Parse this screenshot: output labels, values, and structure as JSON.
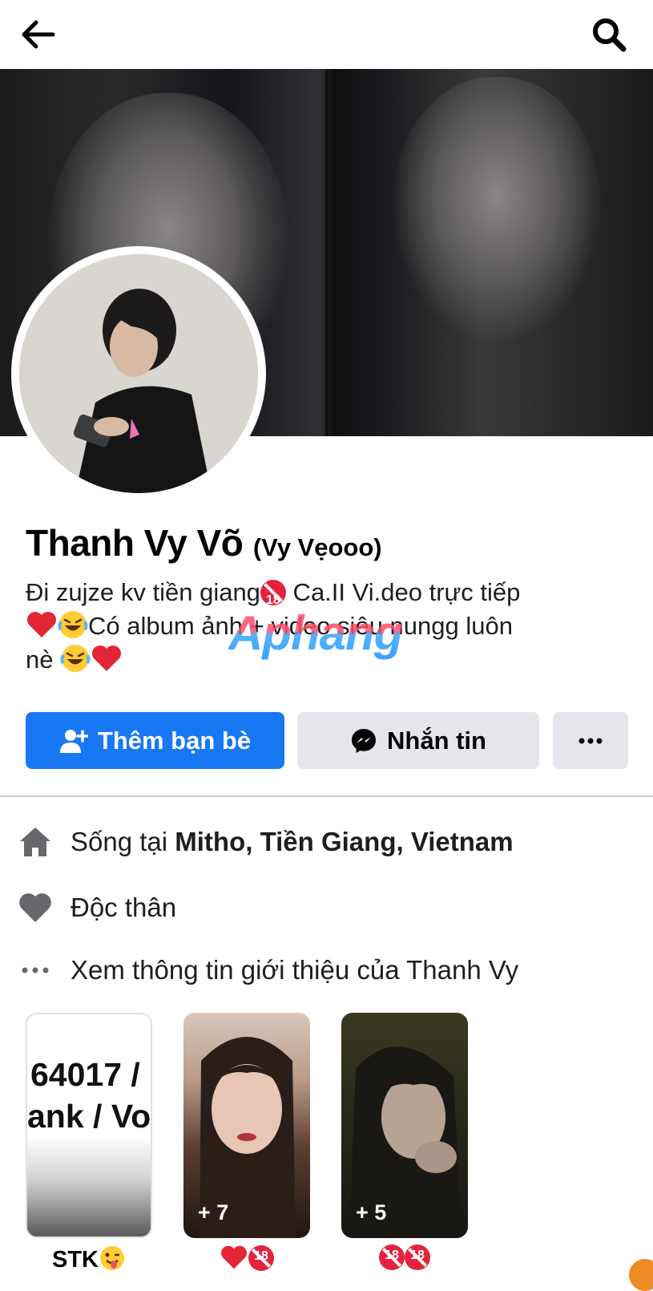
{
  "profile": {
    "name": "Thanh Vy Võ",
    "nickname": "(Vy Vẹooo)",
    "bio_line1_a": "Đi zujze kv tiền giang",
    "bio_line1_b": " Ca.II Vi.deo trực tiếp",
    "bio_line2": "Có album ảnh + video siêu nungg luôn",
    "bio_line3": "nè "
  },
  "watermark": "Aphang",
  "actions": {
    "add_friend_label": "Thêm bạn bè",
    "message_label": "Nhắn tin",
    "more_label": "···"
  },
  "intro": {
    "lives_prefix": "Sống tại ",
    "lives_place": "Mitho, Tiền Giang, Vietnam",
    "relationship": "Độc thân",
    "see_about": "Xem thông tin giới thiệu của Thanh Vy"
  },
  "albums": [
    {
      "label": "STK",
      "count": "",
      "preview_text_1": "64017 /",
      "preview_text_2": "ank / Vo"
    },
    {
      "label": "",
      "count": "+ 7"
    },
    {
      "label": "",
      "count": "+ 5"
    }
  ],
  "icons": {
    "back": "arrow-left-icon",
    "search": "search-icon",
    "add_friend": "user-plus-icon",
    "messenger": "messenger-icon",
    "home": "home-icon",
    "heart": "heart-icon",
    "more": "ellipsis-icon",
    "no_under_18": "no-under-18-icon"
  },
  "colors": {
    "primary": "#1877f2",
    "secondary_button": "#e4e6eb",
    "icon_gray": "#65676b",
    "heart_red": "#e32636"
  }
}
